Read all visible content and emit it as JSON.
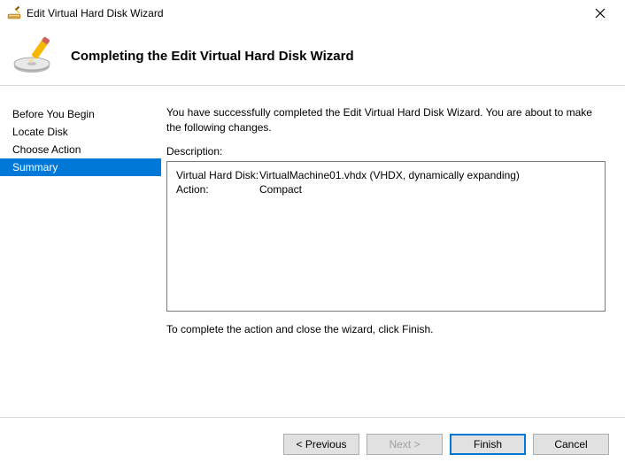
{
  "title": "Edit Virtual Hard Disk Wizard",
  "header_title": "Completing the Edit Virtual Hard Disk Wizard",
  "sidebar": {
    "items": [
      {
        "label": "Before You Begin"
      },
      {
        "label": "Locate Disk"
      },
      {
        "label": "Choose Action"
      },
      {
        "label": "Summary"
      }
    ]
  },
  "content": {
    "intro": "You have successfully completed the Edit Virtual Hard Disk Wizard. You are about to make the following changes.",
    "description_label": "Description:",
    "rows": [
      {
        "key": "Virtual Hard Disk:",
        "value": "VirtualMachine01.vhdx (VHDX, dynamically expanding)"
      },
      {
        "key": "Action:",
        "value": "Compact"
      }
    ],
    "footer": "To complete the action and close the wizard, click Finish."
  },
  "buttons": {
    "previous": "< Previous",
    "next": "Next >",
    "finish": "Finish",
    "cancel": "Cancel"
  }
}
